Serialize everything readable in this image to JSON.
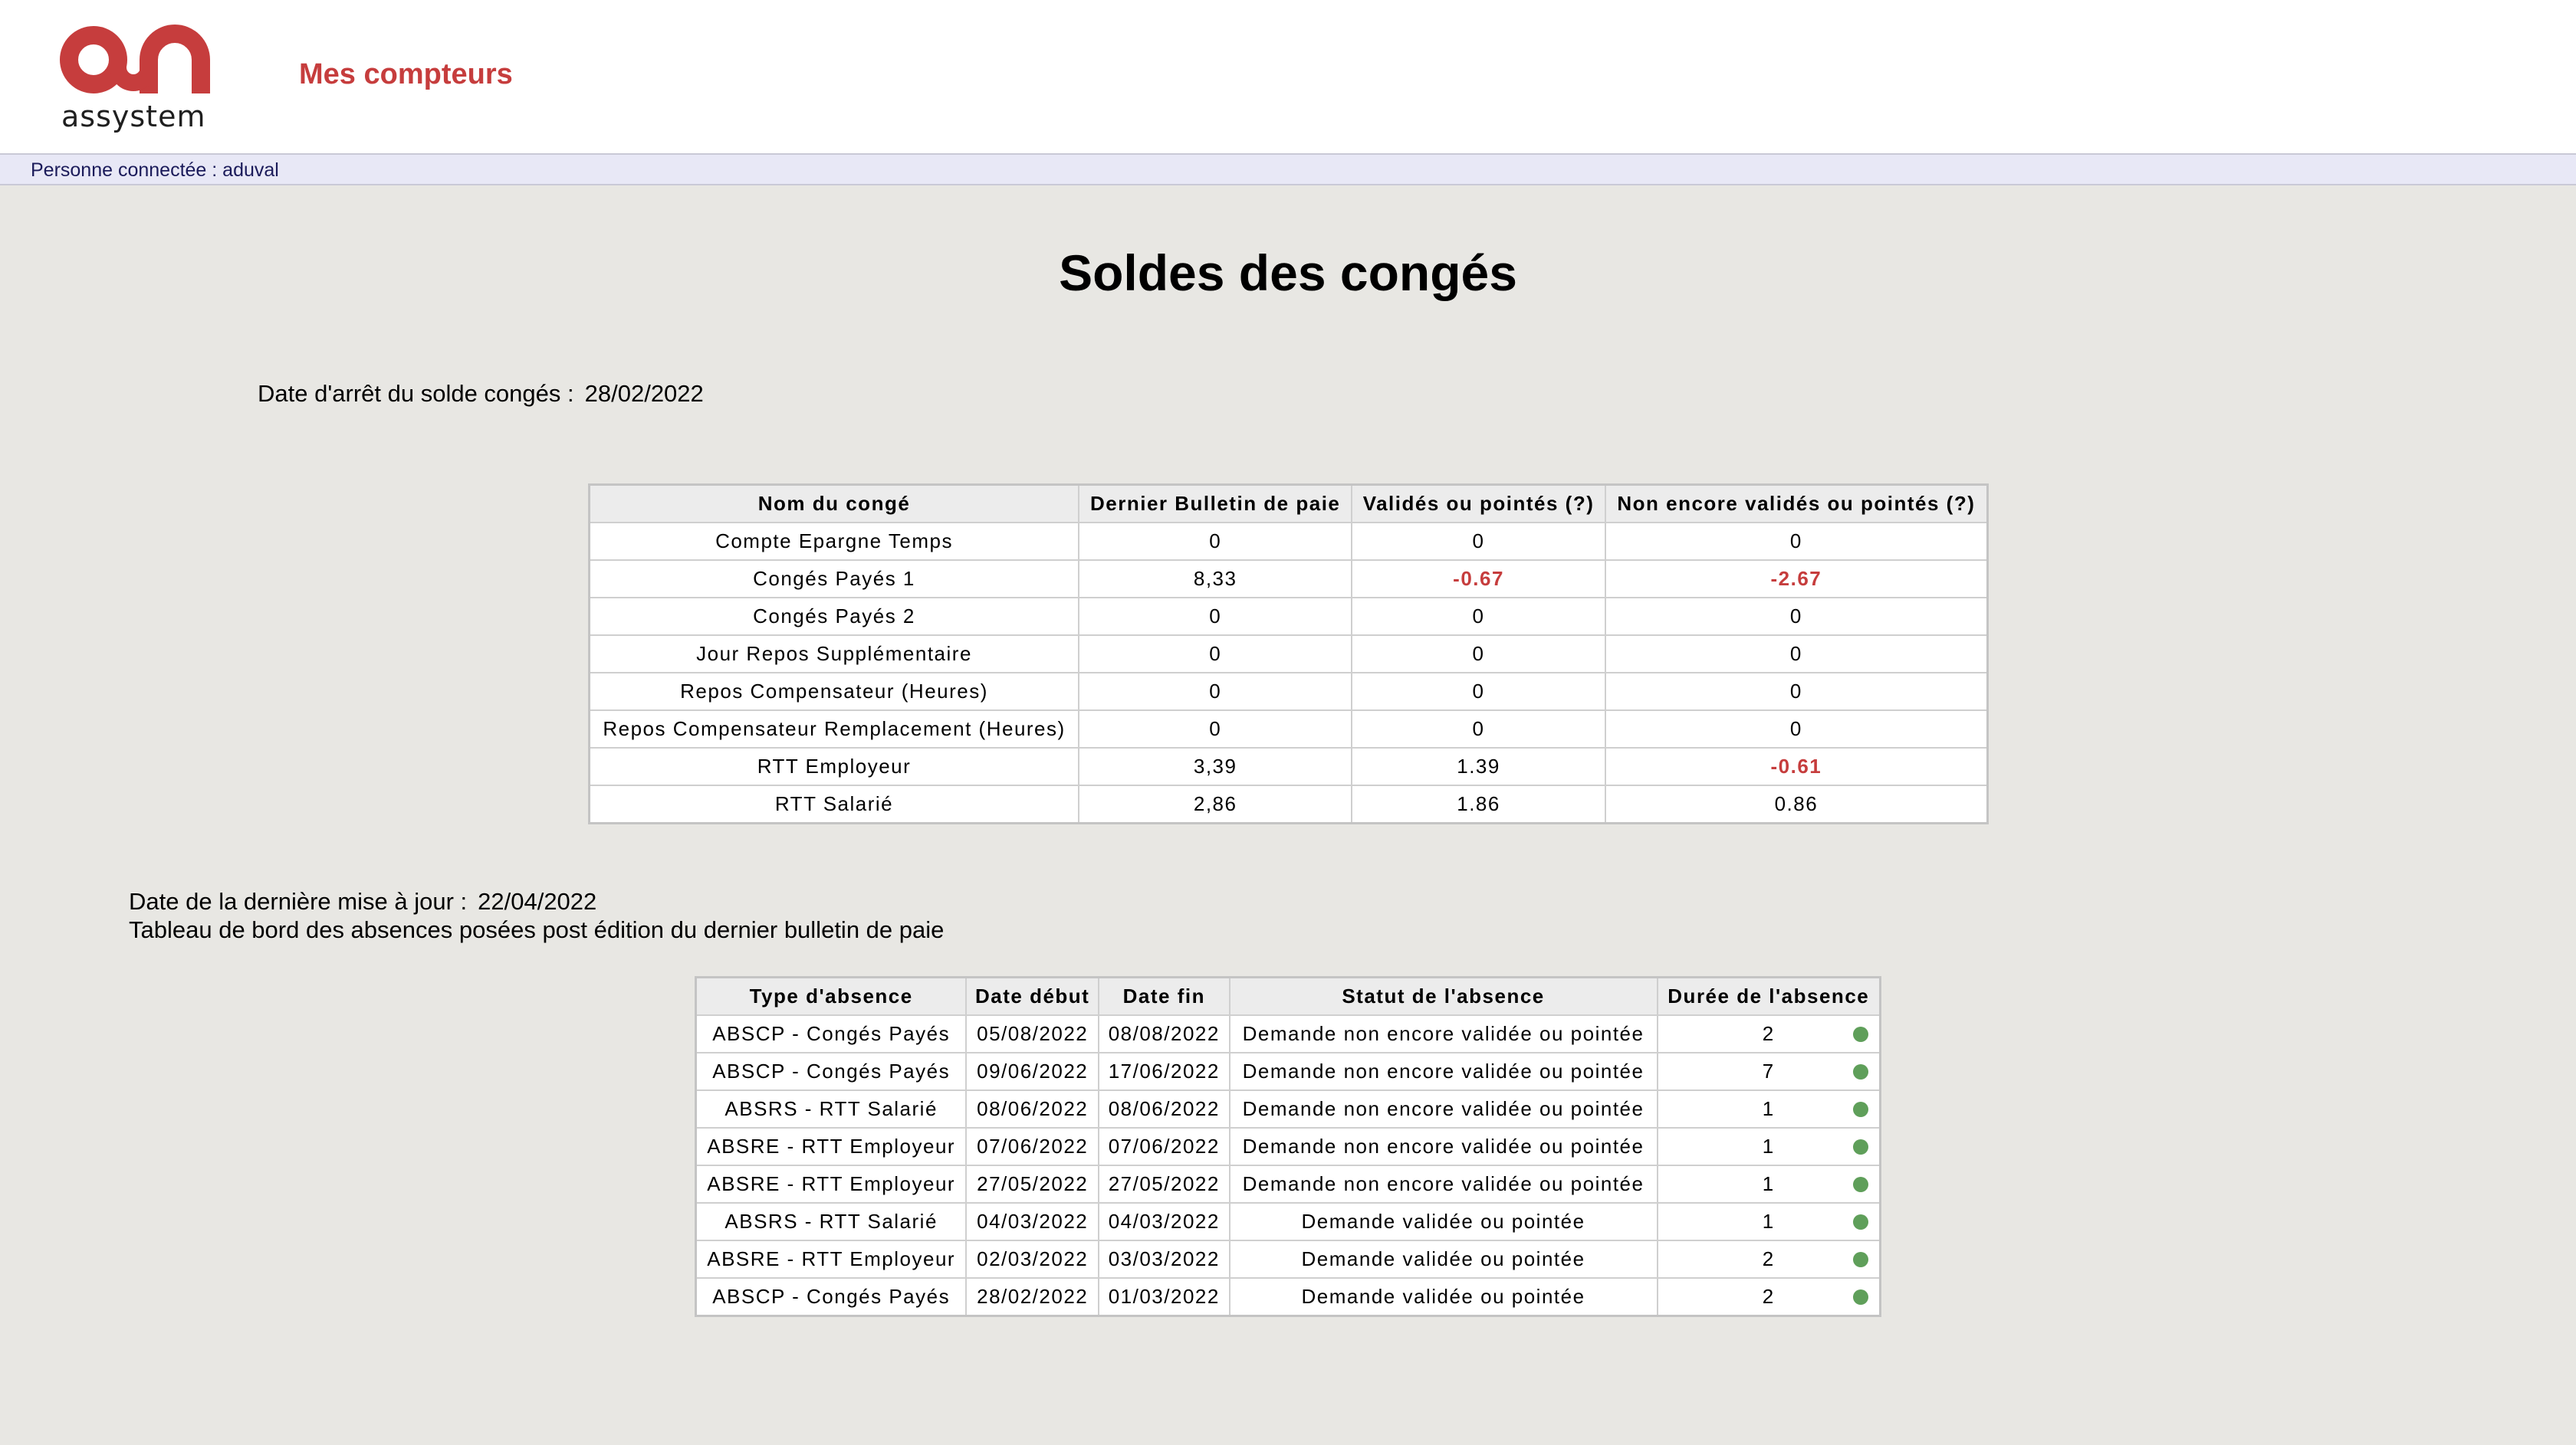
{
  "brand": {
    "logo_text": "assystem",
    "accent_color": "#c63d3d"
  },
  "header": {
    "title": "Mes compteurs"
  },
  "userbar": {
    "text": "Personne connectée : aduval"
  },
  "page": {
    "title": "Soldes des congés",
    "stop_date_label": "Date d'arrêt du solde congés :",
    "stop_date_value": "28/02/2022",
    "update_label": "Date de la dernière mise à jour :",
    "update_value": "22/04/2022",
    "dashboard_note": "Tableau de bord des absences posées post édition du dernier bulletin de paie"
  },
  "balances": {
    "headers": [
      "Nom du congé",
      "Dernier Bulletin de paie",
      "Validés ou pointés (?)",
      "Non encore validés ou pointés (?)"
    ],
    "rows": [
      [
        "Compte Epargne Temps",
        "0",
        "0",
        "0"
      ],
      [
        "Congés Payés 1",
        "8,33",
        "-0.67",
        "-2.67"
      ],
      [
        "Congés Payés 2",
        "0",
        "0",
        "0"
      ],
      [
        "Jour Repos Supplémentaire",
        "0",
        "0",
        "0"
      ],
      [
        "Repos Compensateur (Heures)",
        "0",
        "0",
        "0"
      ],
      [
        "Repos Compensateur Remplacement (Heures)",
        "0",
        "0",
        "0"
      ],
      [
        "RTT Employeur",
        "3,39",
        "1.39",
        "-0.61"
      ],
      [
        "RTT Salarié",
        "2,86",
        "1.86",
        "0.86"
      ]
    ],
    "negative_color": "#c63d3d"
  },
  "absences": {
    "headers": [
      "Type d'absence",
      "Date début",
      "Date fin",
      "Statut de l'absence",
      "Durée de l'absence"
    ],
    "rows": [
      [
        "ABSCP - Congés Payés",
        "05/08/2022",
        "08/08/2022",
        "Demande non encore validée ou pointée",
        "2"
      ],
      [
        "ABSCP - Congés Payés",
        "09/06/2022",
        "17/06/2022",
        "Demande non encore validée ou pointée",
        "7"
      ],
      [
        "ABSRS - RTT Salarié",
        "08/06/2022",
        "08/06/2022",
        "Demande non encore validée ou pointée",
        "1"
      ],
      [
        "ABSRE - RTT Employeur",
        "07/06/2022",
        "07/06/2022",
        "Demande non encore validée ou pointée",
        "1"
      ],
      [
        "ABSRE - RTT Employeur",
        "27/05/2022",
        "27/05/2022",
        "Demande non encore validée ou pointée",
        "1"
      ],
      [
        "ABSRS - RTT Salarié",
        "04/03/2022",
        "04/03/2022",
        "Demande validée ou pointée",
        "1"
      ],
      [
        "ABSRE - RTT Employeur",
        "02/03/2022",
        "03/03/2022",
        "Demande validée ou pointée",
        "2"
      ],
      [
        "ABSCP - Congés Payés",
        "28/02/2022",
        "01/03/2022",
        "Demande validée ou pointée",
        "2"
      ]
    ],
    "status_dot_color": "#5f9f5a",
    "status_icon": "green-status-dot"
  }
}
